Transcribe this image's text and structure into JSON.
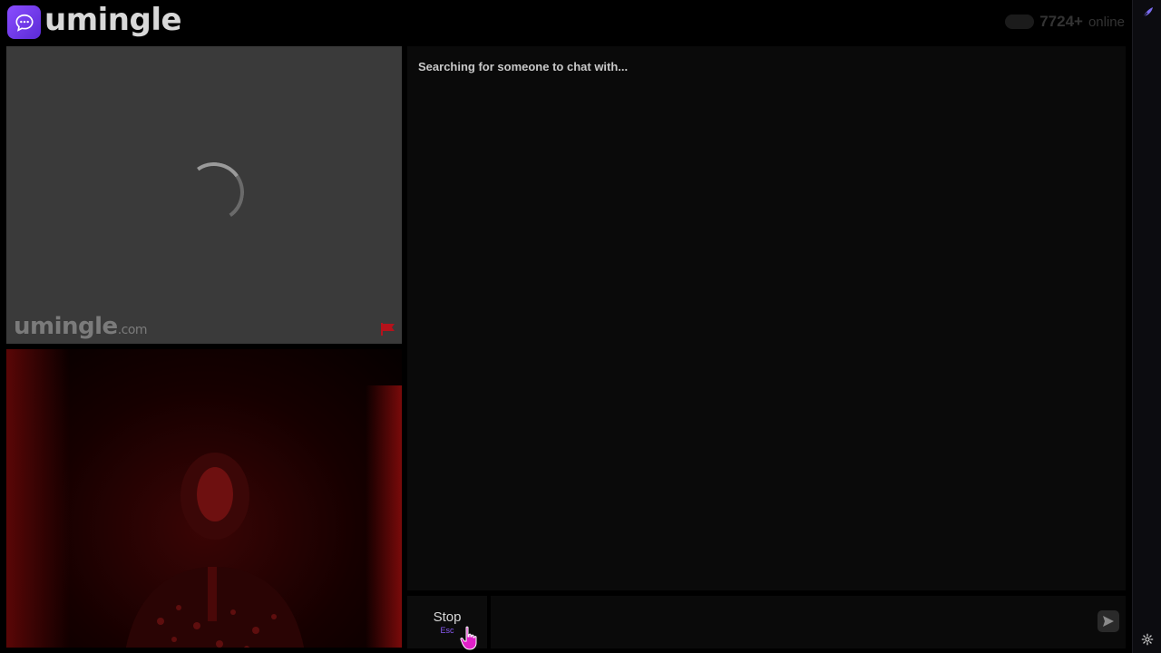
{
  "header": {
    "brand": "umingle",
    "online_count": "7724+",
    "online_label": "online"
  },
  "stranger_video": {
    "watermark_brand": "umingle",
    "watermark_tld": ".com"
  },
  "chat": {
    "status_message": "Searching for someone to chat with...",
    "stop_label": "Stop",
    "stop_shortcut": "Esc",
    "input_placeholder": ""
  },
  "icons": {
    "logo": "chat-bubble-icon",
    "send": "send-icon",
    "report": "flag-icon",
    "settings": "gear-icon",
    "rail_top": "feather-icon"
  },
  "colors": {
    "brand": "#7c3aed",
    "accent": "#8b5cf6",
    "background": "#000000",
    "video_placeholder": "#3a3a3a",
    "report": "#b5121b"
  }
}
